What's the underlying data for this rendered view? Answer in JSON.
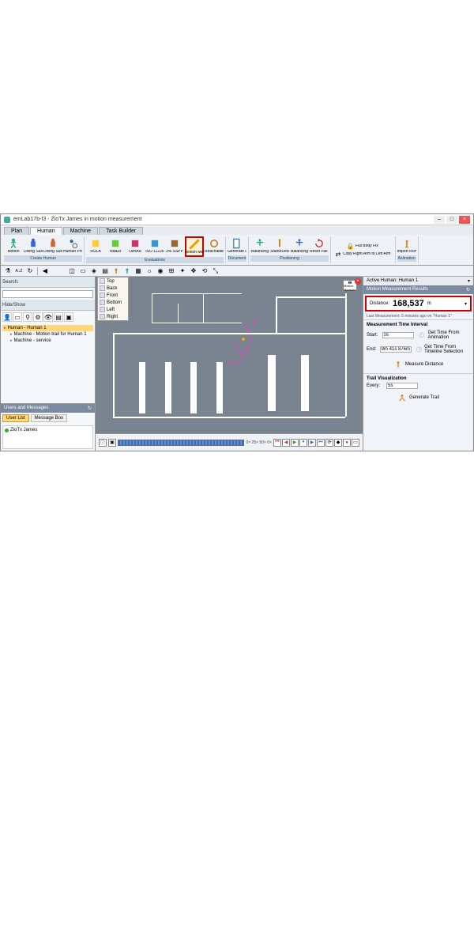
{
  "titlebar": {
    "text": "emLab17b-f3 - ZioTx James in motion measurement"
  },
  "tabs": [
    "Plan",
    "Human",
    "Machine",
    "Task Builder"
  ],
  "activeTab": 1,
  "ribbon": {
    "groups": [
      {
        "label": "Create Human",
        "buttons": [
          {
            "name": "Motion",
            "icon": "person-walk"
          },
          {
            "name": "Diving Suit",
            "icon": "diver"
          },
          {
            "name": "Diving Suit",
            "icon": "diver2"
          },
          {
            "name": "Human Properties",
            "icon": "person-gear"
          }
        ]
      },
      {
        "label": "Evaluations",
        "buttons": [
          {
            "name": "RULA",
            "icon": "rula"
          },
          {
            "name": "NatEd",
            "icon": "nated"
          },
          {
            "name": "OznAR",
            "icon": "oznar"
          },
          {
            "name": "ISO 11226",
            "icon": "iso"
          },
          {
            "name": "3% SSPP",
            "icon": "sspp"
          },
          {
            "name": "Motion Measurement",
            "icon": "measure",
            "highlight": true
          },
          {
            "name": "Reachability Test",
            "icon": "reach"
          }
        ]
      },
      {
        "label": "Document",
        "buttons": [
          {
            "name": "Generate Document",
            "icon": "doc"
          }
        ]
      },
      {
        "label": "Positioning",
        "buttons": [
          {
            "name": "Balancing",
            "icon": "balance"
          },
          {
            "name": "Stand/Descend",
            "icon": "stand"
          },
          {
            "name": "Balancing",
            "icon": "balance2"
          },
          {
            "name": "Reset Full Body",
            "icon": "reset"
          }
        ]
      },
      {
        "label": "",
        "buttons_small": [
          {
            "name": "Full Body Fix",
            "icon": "lock"
          },
          {
            "name": "Copy Right Arm to Left Arm",
            "icon": "copy"
          }
        ]
      },
      {
        "label": "Animation",
        "buttons": [
          {
            "name": "Import Iconic Animation",
            "icon": "anim"
          }
        ]
      }
    ]
  },
  "leftPanel": {
    "searchLabel": "Search:",
    "searchPlaceholder": "",
    "hideShow": "Hide/Show",
    "tree": [
      {
        "label": "Human - Human 1",
        "selected": true
      },
      {
        "label": "Machine - Motion trail for Human 1",
        "child": true
      },
      {
        "label": "Machine - service",
        "child": true
      }
    ],
    "usersHeader": "Users and Messages",
    "userTabs": [
      "User List",
      "Message Box"
    ],
    "users": [
      "ZioTx James"
    ]
  },
  "viewMenu": [
    "Top",
    "Back",
    "Front",
    "Bottom",
    "Left",
    "Right"
  ],
  "cameraLabel": "Motion Measure",
  "rightPanel": {
    "activeLabel": "Active Human:",
    "activeValue": "Human 1",
    "resultsHeader": "Motion Measurement Results",
    "distanceLabel": "Distance:",
    "distanceValue": "168,537",
    "distanceUnit": "m",
    "lastMeas": "Last Measurement: 5 minutes ago on \"Human 1\"",
    "timeSection": "Measurement Time Interval",
    "startLabel": "Start:",
    "startValue": "0s",
    "endLabel": "End:",
    "endValue": "9m 41s 876ms",
    "getTimeAnim": "Get Time From Animation",
    "getTimeSel": "Get Time From Timeline Selection",
    "measureBtn": "Measure Distance",
    "trailSection": "Trail Visualization",
    "everyLabel": "Every:",
    "everyValue": "5s",
    "genTrail": "Generate Trail"
  },
  "timeline": {
    "info": "0× 25× 50× 0×",
    "time": "0"
  }
}
